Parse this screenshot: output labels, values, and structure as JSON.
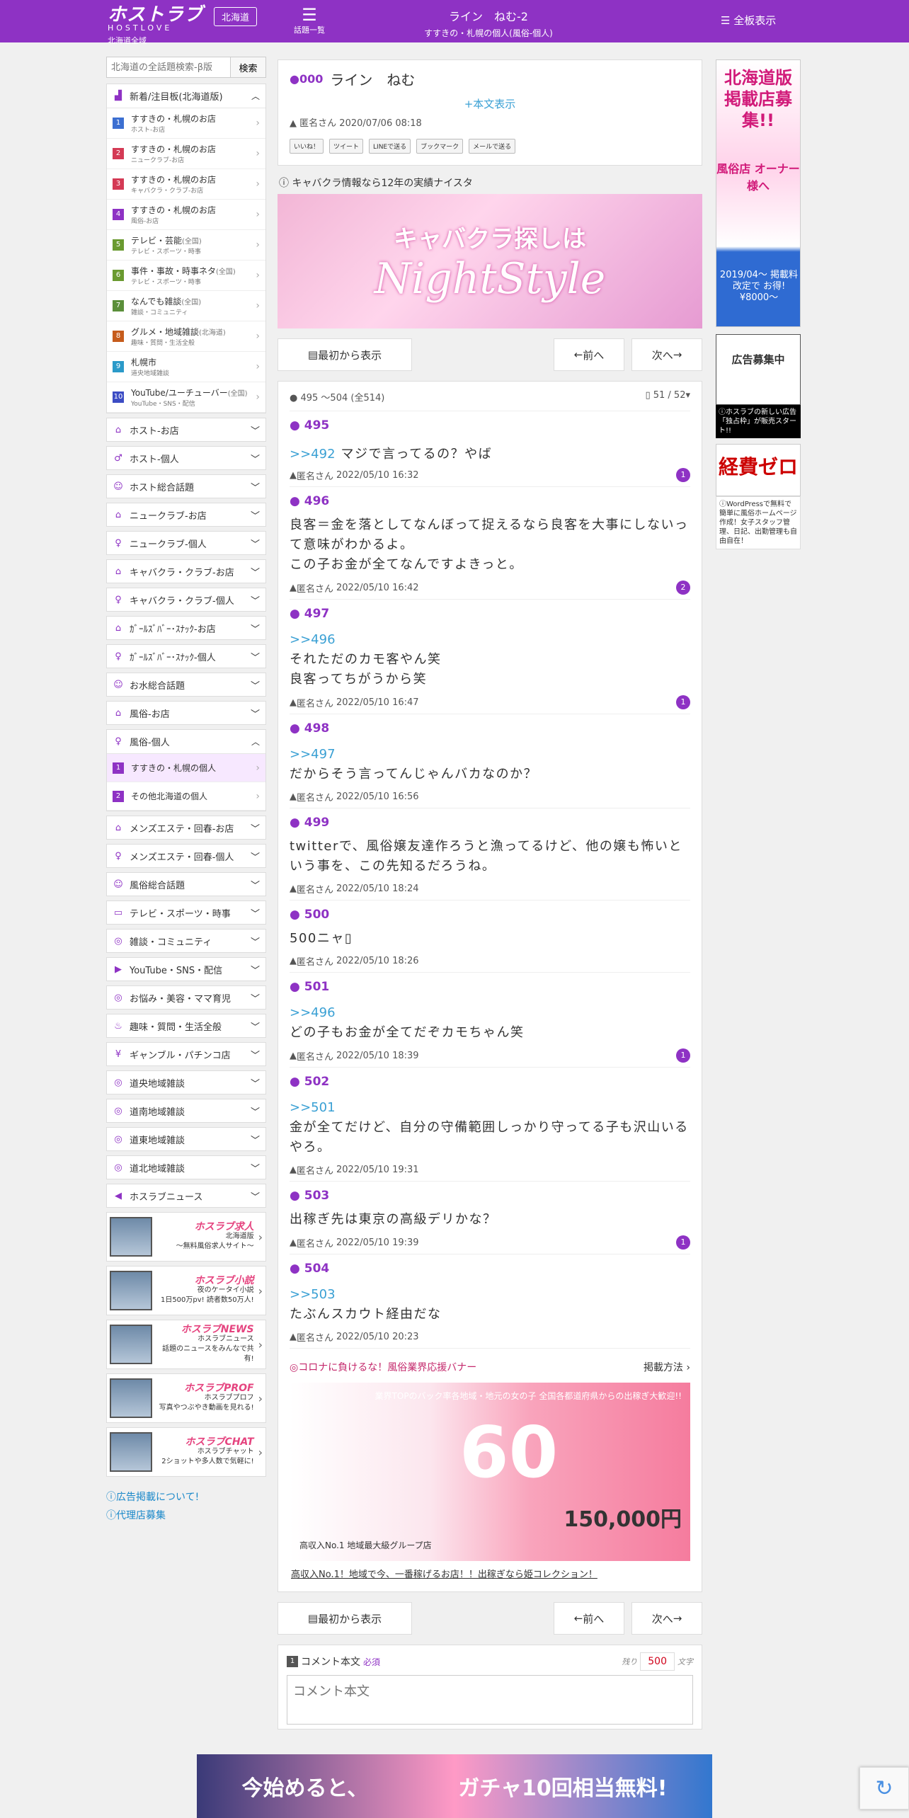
{
  "header": {
    "logo": "ホストラブ",
    "logo_sub": "HOSTLOVE",
    "logo_region": "北海道全域",
    "region_button": "北海道",
    "topics_label": "話題一覧",
    "thread_title": "ライン　ねむ-2",
    "thread_category": "すすきの・札幌の個人(風俗-個人)",
    "all_boards": "全板表示"
  },
  "search": {
    "placeholder": "北海道の全話題検索-β版",
    "button": "検索"
  },
  "new_box": {
    "title": "新着/注目板(北海道版)",
    "items": [
      {
        "num": "1",
        "color": "#3c6fd1",
        "main": "すすきの・札幌のお店",
        "sub": "ホスト-お店"
      },
      {
        "num": "2",
        "color": "#d43a55",
        "main": "すすきの・札幌のお店",
        "sub": "ニュークラブ-お店"
      },
      {
        "num": "3",
        "color": "#d43a55",
        "main": "すすきの・札幌のお店",
        "sub": "キャバクラ・クラブ-お店"
      },
      {
        "num": "4",
        "color": "#8e32c4",
        "main": "すすきの・札幌のお店",
        "sub": "風俗-お店"
      },
      {
        "num": "5",
        "color": "#6a9a30",
        "main": "テレビ・芸能",
        "extra": "(全国)",
        "sub": "テレビ・スポーツ・時事"
      },
      {
        "num": "6",
        "color": "#6a9a30",
        "main": "事件・事故・時事ネタ",
        "extra": "(全国)",
        "sub": "テレビ・スポーツ・時事"
      },
      {
        "num": "7",
        "color": "#5b8f3a",
        "main": "なんでも雑談",
        "extra": "(全国)",
        "sub": "雑談・コミュニティ"
      },
      {
        "num": "8",
        "color": "#c65c1c",
        "main": "グルメ・地域雑談",
        "extra": "(北海道)",
        "sub": "趣味・質問・生活全般"
      },
      {
        "num": "9",
        "color": "#2b9ac9",
        "main": "札幌市",
        "sub": "道央地域雑談"
      },
      {
        "num": "10",
        "color": "#3c4cc4",
        "main": "YouTube/ユーチューバー",
        "extra": "(全国)",
        "sub": "YouTube・SNS・配信"
      }
    ]
  },
  "categories_top": [
    {
      "icon": "house-icon",
      "glyph": "⌂",
      "label": "ホスト-お店"
    },
    {
      "icon": "person-icon",
      "glyph": "♂",
      "label": "ホスト-個人"
    },
    {
      "icon": "group-icon",
      "glyph": "☺",
      "label": "ホスト総合話題"
    },
    {
      "icon": "house-icon",
      "glyph": "⌂",
      "label": "ニュークラブ-お店"
    },
    {
      "icon": "person-icon",
      "glyph": "♀",
      "label": "ニュークラブ-個人"
    },
    {
      "icon": "house-icon",
      "glyph": "⌂",
      "label": "キャバクラ・クラブ-お店"
    },
    {
      "icon": "person-icon",
      "glyph": "♀",
      "label": "キャバクラ・クラブ-個人"
    },
    {
      "icon": "house-icon",
      "glyph": "⌂",
      "label": "ｶﾞｰﾙｽﾞﾊﾞｰ･ｽﾅｯｸ-お店"
    },
    {
      "icon": "person-icon",
      "glyph": "♀",
      "label": "ｶﾞｰﾙｽﾞﾊﾞｰ･ｽﾅｯｸ-個人"
    },
    {
      "icon": "group-icon",
      "glyph": "☺",
      "label": "お水総合話題"
    },
    {
      "icon": "house-icon",
      "glyph": "⌂",
      "label": "風俗-お店"
    }
  ],
  "fuzoku_box": {
    "title": "風俗-個人",
    "items": [
      {
        "num": "1",
        "color": "#8e32c4",
        "main": "すすきの・札幌の個人",
        "active": true
      },
      {
        "num": "2",
        "color": "#8e32c4",
        "main": "その他北海道の個人"
      }
    ]
  },
  "categories_bottom": [
    {
      "icon": "house-icon",
      "glyph": "⌂",
      "label": "メンズエステ・回春-お店"
    },
    {
      "icon": "person-icon",
      "glyph": "♀",
      "label": "メンズエステ・回春-個人"
    },
    {
      "icon": "group-icon",
      "glyph": "☺",
      "label": "風俗総合話題"
    },
    {
      "icon": "tv-icon",
      "glyph": "▭",
      "label": "テレビ・スポーツ・時事"
    },
    {
      "icon": "chat-icon",
      "glyph": "◎",
      "label": "雑談・コミュニティ"
    },
    {
      "icon": "youtube-icon",
      "glyph": "▶",
      "label": "YouTube・SNS・配信"
    },
    {
      "icon": "chat-icon",
      "glyph": "◎",
      "label": "お悩み・美容・ママ育児"
    },
    {
      "icon": "fork-icon",
      "glyph": "♨",
      "label": "趣味・質問・生活全般"
    },
    {
      "icon": "money-icon",
      "glyph": "¥",
      "label": "ギャンブル・パチンコ店"
    },
    {
      "icon": "chat-icon",
      "glyph": "◎",
      "label": "道央地域雑談"
    },
    {
      "icon": "chat-icon",
      "glyph": "◎",
      "label": "道南地域雑談"
    },
    {
      "icon": "chat-icon",
      "glyph": "◎",
      "label": "道東地域雑談"
    },
    {
      "icon": "chat-icon",
      "glyph": "◎",
      "label": "道北地域雑談"
    },
    {
      "icon": "speaker-icon",
      "glyph": "◀",
      "label": "ホスラブニュース"
    }
  ],
  "services": [
    {
      "name": "ホスラブ求人",
      "l1": "北海道版",
      "l2": "〜無料風俗求人サイト〜"
    },
    {
      "name": "ホスラブ小説",
      "l1": "夜のケータイ小説",
      "l2": "1日500万pv! 読者数50万人!"
    },
    {
      "name": "ホスラブNEWS",
      "l1": "ホスラブニュース",
      "l2": "話題のニュースをみんなで共有!"
    },
    {
      "name": "ホスラブPROF",
      "l1": "ホスラブプロフ",
      "l2": "写真やつぶやき動画を見れる!"
    },
    {
      "name": "ホスラブCHAT",
      "l1": "ホスラブチャット",
      "l2": "2ショットや多人数で気軽に!"
    }
  ],
  "side_links": [
    "広告掲載について!",
    "代理店募集"
  ],
  "thread": {
    "num": "000",
    "title": "ライン　ねむ",
    "more": "+本文表示",
    "author": "匿名さん",
    "date": "2020/07/06 08:18",
    "share": [
      "いいね！",
      "ツイート",
      "LINEで送る",
      "ブックマーク",
      "メールで送る"
    ]
  },
  "ad_top": {
    "title": "キャバクラ情報なら12年の実績ナイスタ",
    "line1": "キャバクラ探しは",
    "line2": "NightStyle"
  },
  "nav": {
    "first": "最初から表示",
    "prev": "前へ",
    "next": "次へ"
  },
  "posts_bar": {
    "range": "495 ～504 (全514)",
    "page": "51 / 52"
  },
  "posts": [
    {
      "num": "495",
      "anchor": ">>492",
      "inline": "マジで言ってるの？やば",
      "body": "",
      "author": "匿名さん",
      "date": "2022/05/10 16:32",
      "badge": "1"
    },
    {
      "num": "496",
      "anchor": "",
      "inline": "",
      "body": "良客＝金を落としてなんぼって捉えるなら良客を大事にしないって意味がわかるよ。\nこの子お金が全てなんですよきっと。",
      "author": "匿名さん",
      "date": "2022/05/10 16:42",
      "badge": "2"
    },
    {
      "num": "497",
      "anchor": ">>496",
      "inline": "",
      "body": "それただのカモ客やん笑\n良客ってちがうから笑",
      "author": "匿名さん",
      "date": "2022/05/10 16:47",
      "badge": "1"
    },
    {
      "num": "498",
      "anchor": ">>497",
      "inline": "",
      "body": "だからそう言ってんじゃんバカなのか？",
      "author": "匿名さん",
      "date": "2022/05/10 16:56",
      "badge": ""
    },
    {
      "num": "499",
      "anchor": "",
      "inline": "",
      "body": "twitterで、風俗嬢友達作ろうと漁ってるけど、他の嬢も怖いという事を、この先知るだろうね。",
      "author": "匿名さん",
      "date": "2022/05/10 18:24",
      "badge": ""
    },
    {
      "num": "500",
      "anchor": "",
      "inline": "",
      "body": "500ニャ▯",
      "author": "匿名さん",
      "date": "2022/05/10 18:26",
      "badge": ""
    },
    {
      "num": "501",
      "anchor": ">>496",
      "inline": "",
      "body": "どの子もお金が全てだぞカモちゃん笑",
      "author": "匿名さん",
      "date": "2022/05/10 18:39",
      "badge": "1"
    },
    {
      "num": "502",
      "anchor": ">>501",
      "inline": "",
      "body": "金が全てだけど、自分の守備範囲しっかり守ってる子も沢山いるやろ。",
      "author": "匿名さん",
      "date": "2022/05/10 19:31",
      "badge": ""
    },
    {
      "num": "503",
      "anchor": "",
      "inline": "",
      "body": "出稼ぎ先は東京の高級デリかな？",
      "author": "匿名さん",
      "date": "2022/05/10 19:39",
      "badge": "1"
    },
    {
      "num": "504",
      "anchor": ">>503",
      "inline": "",
      "body": "たぶんスカウト経由だな",
      "author": "匿名さん",
      "date": "2022/05/10 20:23",
      "badge": ""
    }
  ],
  "pr": {
    "title": "◎コロナに負けるな！風俗業界応援バナー",
    "howto": "掲載方法",
    "top": "業界TOPのバック率各地域・地元の女の子 全国各都道府県からの出稼ぎ大歓迎!!",
    "big": "60",
    "pay": "150,000円",
    "no1": "高収入No.1 地域最大級グループ店",
    "link": "高収入No.1！地域で今、一番稼げるお店！！出稼ぎなら姫コレクション！"
  },
  "form": {
    "label": "コメント本文",
    "required": "必須",
    "remain_label": "残り",
    "remain": "500",
    "unit": "文字",
    "placeholder": "コメント本文"
  },
  "right_ads": {
    "ad1_head": "北海道版掲載店募集!!",
    "ad1_sub": "風俗店 オーナー様へ",
    "ad1_foot": "2019/04〜 掲載料改定で お得!¥8000〜",
    "ad2_head": "広告募集中",
    "ad2_note": "ホスラブの新しい広告「独占枠」が販売スタート!!",
    "ad3_head": "経費ゼロ",
    "ad3_note": "WordPressで無料で簡単に風俗ホームページ作成！女子スタッフ管理、日記、出勤管理も自由自在！"
  },
  "bottom_ad": {
    "l": "今始めると、",
    "r": "ガチャ10回相当無料!"
  }
}
